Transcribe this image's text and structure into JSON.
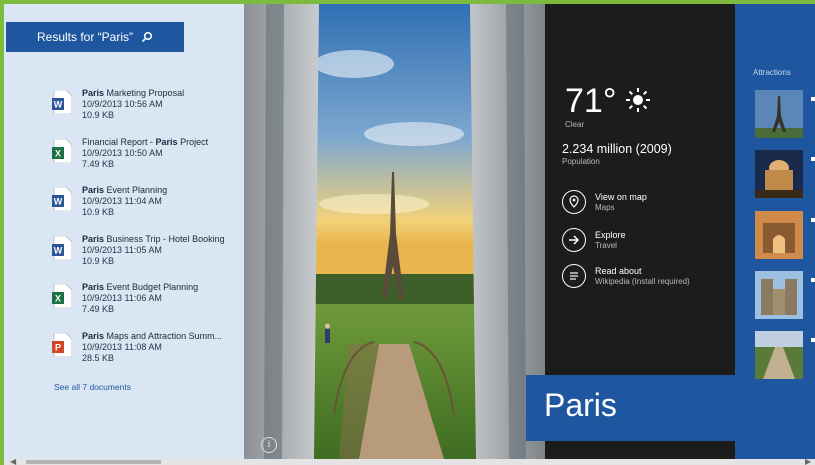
{
  "search": {
    "results_title": "Results for “Paris”"
  },
  "documents": [
    {
      "bold": "Paris",
      "name_pre": "",
      "name_post": " Marketing Proposal",
      "date": "10/9/2013 10:56 AM",
      "size": "10.9 KB",
      "type": "word"
    },
    {
      "bold": "Paris",
      "name_pre": "Financial Report - ",
      "name_post": " Project",
      "date": "10/9/2013 10:50 AM",
      "size": "7.49 KB",
      "type": "excel"
    },
    {
      "bold": "Paris",
      "name_pre": "",
      "name_post": " Event Planning",
      "date": "10/9/2013 11:04 AM",
      "size": "10.9 KB",
      "type": "word"
    },
    {
      "bold": "Paris",
      "name_pre": "",
      "name_post": " Business Trip - Hotel Booking",
      "date": "10/9/2013 11:05 AM",
      "size": "10.9 KB",
      "type": "word"
    },
    {
      "bold": "Paris",
      "name_pre": "",
      "name_post": " Event Budget Planning",
      "date": "10/9/2013 11:06 AM",
      "size": "7.49 KB",
      "type": "excel"
    },
    {
      "bold": "Paris",
      "name_pre": "",
      "name_post": " Maps and Attraction Summ...",
      "date": "10/9/2013 11:08 AM",
      "size": "28.5 KB",
      "type": "powerpoint"
    }
  ],
  "see_all": "See all 7 documents",
  "weather": {
    "temp": "71°",
    "condition": "Clear",
    "icon": "sun-icon"
  },
  "population": {
    "value": "2.234 million (2009)",
    "label": "Population"
  },
  "actions": [
    {
      "title": "View on map",
      "sub": "Maps",
      "icon": "map-pin-icon"
    },
    {
      "title": "Explore",
      "sub": "Travel",
      "icon": "arrow-right-icon"
    },
    {
      "title": "Read about",
      "sub": "Wikipedia (Install required)",
      "icon": "document-icon"
    }
  ],
  "place": {
    "name": "Paris"
  },
  "attractions": {
    "label": "Attractions"
  },
  "colors": {
    "accent": "#1e56a0",
    "frame": "#7dbb3e",
    "panel": "#1c1c1c"
  }
}
